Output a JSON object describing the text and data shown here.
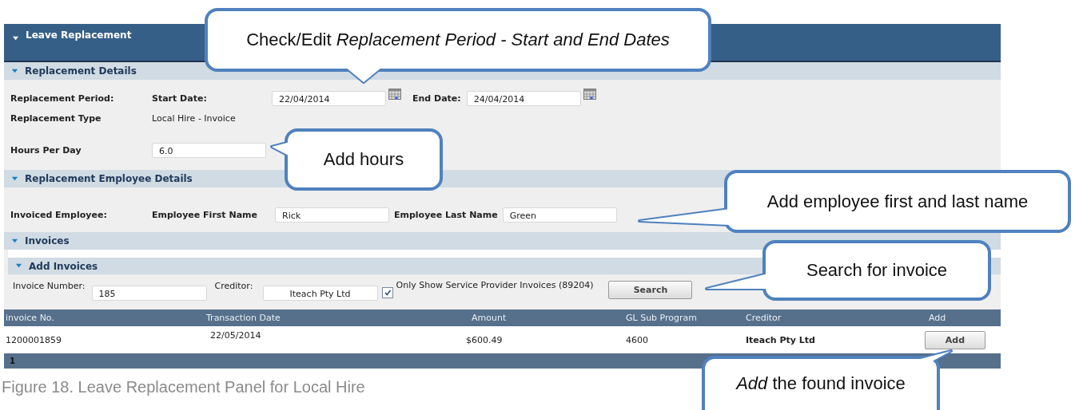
{
  "panel": {
    "title": "Leave Replacement",
    "expanded": true
  },
  "replacement_details": {
    "title": "Replacement Details",
    "expanded": true,
    "period_label": "Replacement Period:",
    "start_label": "Start Date:",
    "start_value": "22/04/2014",
    "end_label": "End Date:",
    "end_value": "24/04/2014",
    "type_label": "Replacement Type",
    "type_value": "Local Hire - Invoice",
    "hours_label": "Hours Per Day",
    "hours_value": "6.0"
  },
  "employee_details": {
    "title": "Replacement Employee Details",
    "expanded": true,
    "invoiced_label": "Invoiced Employee:",
    "first_label": "Employee First Name",
    "first_value": "Rick",
    "last_label": "Employee Last Name",
    "last_value": "Green"
  },
  "invoices": {
    "title": "Invoices",
    "expanded": true
  },
  "add_invoices": {
    "title": "Add Invoices",
    "expanded": true,
    "number_label": "Invoice Number:",
    "number_value": "185",
    "creditor_label": "Creditor:",
    "creditor_value": "Iteach Pty Ltd",
    "filter": {
      "label": "Only Show Service Provider Invoices (89204)",
      "checked": true
    },
    "search_button": "Search"
  },
  "table": {
    "columns": [
      "invoice No.",
      "Transaction Date",
      "Amount",
      "GL Sub Program",
      "Creditor",
      "Add"
    ],
    "rows": [
      {
        "cells": [
          "1200001859",
          "22/05/2014",
          "$600.49",
          "4600",
          "Iteach Pty Ltd"
        ],
        "button": "Add"
      }
    ],
    "pager": "1"
  },
  "callouts": [
    "Check/Edit *Replacement Period - Start and End Dates*",
    "Add hours",
    "Add employee first and last name",
    "Search for invoice",
    "*Add* the found invoice"
  ],
  "caption": "Figure 18. Leave Replacement Panel for Local Hire"
}
